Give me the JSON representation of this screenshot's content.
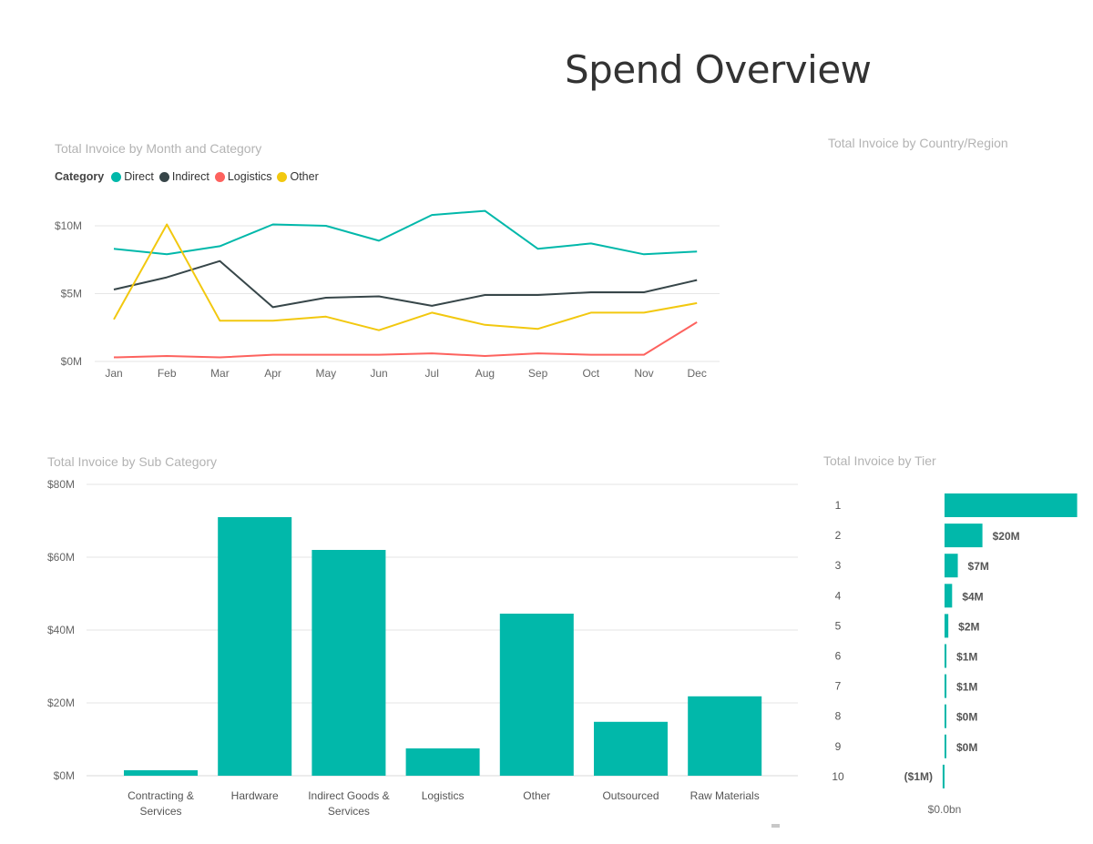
{
  "page": {
    "title": "Spend Overview"
  },
  "visuals": {
    "line": {
      "title": "Total Invoice by Month and Category"
    },
    "map": {
      "title": "Total Invoice by Country/Region"
    },
    "column": {
      "title": "Total Invoice by Sub Category"
    },
    "tier": {
      "title": "Total Invoice by Tier"
    }
  },
  "legend": {
    "title": "Category",
    "items": [
      {
        "label": "Direct",
        "color": "#01b8aa"
      },
      {
        "label": "Indirect",
        "color": "#374649"
      },
      {
        "label": "Logistics",
        "color": "#fd625e"
      },
      {
        "label": "Other",
        "color": "#f2c80f"
      }
    ]
  },
  "chart_data": [
    {
      "type": "line",
      "title": "Total Invoice by Month and Category",
      "x": [
        "Jan",
        "Feb",
        "Mar",
        "Apr",
        "May",
        "Jun",
        "Jul",
        "Aug",
        "Sep",
        "Oct",
        "Nov",
        "Dec"
      ],
      "ylim": [
        0,
        10
      ],
      "yticks": [
        {
          "v": 0,
          "label": "$0M"
        },
        {
          "v": 5,
          "label": "$5M"
        },
        {
          "v": 10,
          "label": "$10M"
        }
      ],
      "grid": true,
      "legend_position": "top-left",
      "series": [
        {
          "name": "Direct",
          "color": "#01b8aa",
          "values": [
            8.3,
            7.9,
            8.5,
            10.1,
            10.0,
            8.9,
            10.8,
            11.1,
            8.3,
            8.7,
            7.9,
            8.1
          ]
        },
        {
          "name": "Indirect",
          "color": "#374649",
          "values": [
            5.3,
            6.2,
            7.4,
            4.0,
            4.7,
            4.8,
            4.1,
            4.9,
            4.9,
            5.1,
            5.1,
            6.0
          ]
        },
        {
          "name": "Logistics",
          "color": "#fd625e",
          "values": [
            0.3,
            0.4,
            0.3,
            0.5,
            0.5,
            0.5,
            0.6,
            0.4,
            0.6,
            0.5,
            0.5,
            2.9
          ]
        },
        {
          "name": "Other",
          "color": "#f2c80f",
          "values": [
            3.1,
            10.1,
            3.0,
            3.0,
            3.3,
            2.3,
            3.6,
            2.7,
            2.4,
            3.6,
            3.6,
            4.3
          ]
        }
      ]
    },
    {
      "type": "bar",
      "title": "Total Invoice by Sub Category",
      "categories": [
        [
          "Contracting &",
          "Services"
        ],
        [
          "Hardware"
        ],
        [
          "Indirect Goods &",
          "Services"
        ],
        [
          "Logistics"
        ],
        [
          "Other"
        ],
        [
          "Outsourced"
        ],
        [
          "Raw Materials"
        ]
      ],
      "values": [
        1.5,
        71,
        62,
        7.5,
        44.5,
        14.8,
        21.8
      ],
      "ylim": [
        0,
        80
      ],
      "yticks": [
        {
          "v": 0,
          "label": "$0M"
        },
        {
          "v": 20,
          "label": "$20M"
        },
        {
          "v": 40,
          "label": "$40M"
        },
        {
          "v": 60,
          "label": "$60M"
        },
        {
          "v": 80,
          "label": "$80M"
        }
      ],
      "grid": true,
      "color": "#01b8aa"
    },
    {
      "type": "bar",
      "orientation": "horizontal",
      "title": "Total Invoice by Tier",
      "categories": [
        "1",
        "2",
        "3",
        "4",
        "5",
        "6",
        "7",
        "8",
        "9",
        "10"
      ],
      "values": [
        70,
        20,
        7,
        4,
        2,
        1,
        1,
        0,
        0,
        -1
      ],
      "data_labels": [
        "",
        "$20M",
        "$7M",
        "$4M",
        "$2M",
        "$1M",
        "$1M",
        "$0M",
        "$0M",
        "($1M)"
      ],
      "axis_label": "$0.0bn",
      "color": "#01b8aa"
    }
  ]
}
